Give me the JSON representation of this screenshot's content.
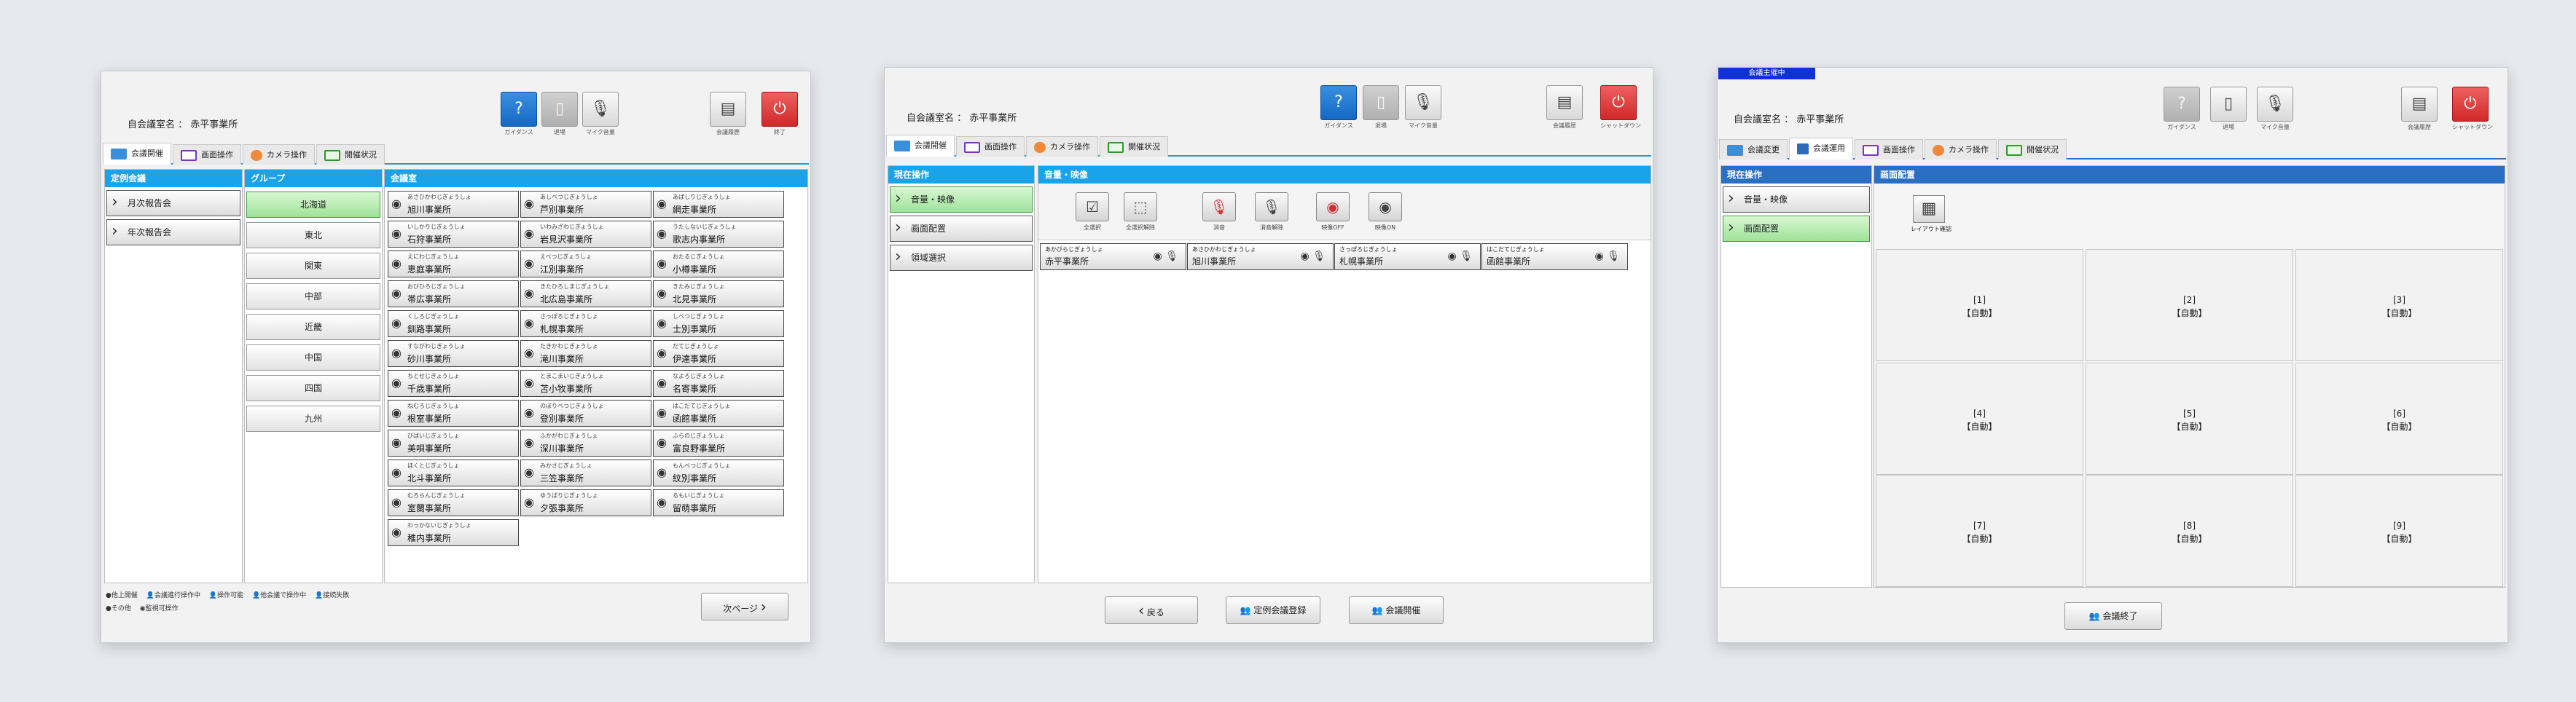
{
  "room_label": "自会議室名 ： 赤平事業所",
  "toolbar": {
    "guidance": "ガイダンス",
    "exit_room": "退場",
    "mic_volume": "マイク音量",
    "meeting_history": "会議履歴",
    "shutdown": "シャットダウン",
    "end": "終了"
  },
  "icons": {
    "guidance": "question-icon",
    "exit": "door-icon",
    "mic": "mic-icon",
    "history": "document-icon",
    "power": "power-icon",
    "chevron": "chevron-right-icon",
    "eye": "eye-icon"
  },
  "colors": {
    "accent": "#1aa3e8",
    "selected": "#9fe29a",
    "danger": "#d02828"
  },
  "tabs": [
    "会議開催",
    "画面操作",
    "カメラ操作",
    "開催状況"
  ],
  "panel1": {
    "col_meetings": {
      "header": "定例会議",
      "items": [
        "月次報告会",
        "年次報告会"
      ]
    },
    "col_groups": {
      "header": "グループ",
      "items": [
        "北海道",
        "東北",
        "関東",
        "中部",
        "近畿",
        "中国",
        "四国",
        "九州"
      ]
    },
    "col_sites": {
      "header": "会議室",
      "items": [
        {
          "kana": "あさひかわじぎょうしょ",
          "name": "旭川事業所"
        },
        {
          "kana": "あしべつじぎょうしょ",
          "name": "芦別事業所"
        },
        {
          "kana": "あばしりじぎょうしょ",
          "name": "網走事業所"
        },
        {
          "kana": "いしかりじぎょうしょ",
          "name": "石狩事業所"
        },
        {
          "kana": "いわみざわじぎょうしょ",
          "name": "岩見沢事業所"
        },
        {
          "kana": "うたしないじぎょうしょ",
          "name": "歌志内事業所"
        },
        {
          "kana": "えにわじぎょうしょ",
          "name": "恵庭事業所"
        },
        {
          "kana": "えべつじぎょうしょ",
          "name": "江別事業所"
        },
        {
          "kana": "おたるじぎょうしょ",
          "name": "小樽事業所"
        },
        {
          "kana": "おびひろじぎょうしょ",
          "name": "帯広事業所"
        },
        {
          "kana": "きたひろしまじぎょうしょ",
          "name": "北広島事業所"
        },
        {
          "kana": "きたみじぎょうしょ",
          "name": "北見事業所"
        },
        {
          "kana": "くしろじぎょうしょ",
          "name": "釧路事業所"
        },
        {
          "kana": "さっぽろじぎょうしょ",
          "name": "札幌事業所"
        },
        {
          "kana": "しべつじぎょうしょ",
          "name": "士別事業所"
        },
        {
          "kana": "すながわじぎょうしょ",
          "name": "砂川事業所"
        },
        {
          "kana": "たきかわじぎょうしょ",
          "name": "滝川事業所"
        },
        {
          "kana": "だてじぎょうしょ",
          "name": "伊達事業所"
        },
        {
          "kana": "ちとせじぎょうしょ",
          "name": "千歳事業所"
        },
        {
          "kana": "とまこまいじぎょうしょ",
          "name": "苫小牧事業所"
        },
        {
          "kana": "なよろじぎょうしょ",
          "name": "名寄事業所"
        },
        {
          "kana": "ねむろじぎょうしょ",
          "name": "根室事業所"
        },
        {
          "kana": "のぼりべつじぎょうしょ",
          "name": "登別事業所"
        },
        {
          "kana": "はこだてじぎょうしょ",
          "name": "函館事業所"
        },
        {
          "kana": "びばいじぎょうしょ",
          "name": "美唄事業所"
        },
        {
          "kana": "ふかがわじぎょうしょ",
          "name": "深川事業所"
        },
        {
          "kana": "ふらのじぎょうしょ",
          "name": "富良野事業所"
        },
        {
          "kana": "ほくとじぎょうしょ",
          "name": "北斗事業所"
        },
        {
          "kana": "みかさじぎょうしょ",
          "name": "三笠事業所"
        },
        {
          "kana": "もんべつじぎょうしょ",
          "name": "紋別事業所"
        },
        {
          "kana": "むろらんじぎょうしょ",
          "name": "室蘭事業所"
        },
        {
          "kana": "ゆうばりじぎょうしょ",
          "name": "夕張事業所"
        },
        {
          "kana": "るもいじぎょうしょ",
          "name": "留萌事業所"
        },
        {
          "kana": "わっかないじぎょうしょ",
          "name": "稚内事業所"
        }
      ]
    },
    "legend": {
      "l1": "●他上開催",
      "l2": "会議進行操作中",
      "l3": "操作可能",
      "l4": "他会議で操作中",
      "l5": "接続失敗",
      "l6": "●その他",
      "l7": "監視可操作"
    },
    "next_page": "次ページ"
  },
  "panel2": {
    "left_header": "現在操作",
    "left_items": [
      "音量・映像",
      "画面配置",
      "領域選択"
    ],
    "right_header": "音量・映像",
    "controls": [
      "全選択",
      "全選択解除",
      "消音",
      "消音解除",
      "映像OFF",
      "映像ON"
    ],
    "sites": [
      {
        "kana": "あかびらじぎょうしょ",
        "name": "赤平事業所"
      },
      {
        "kana": "あさひかわじぎょうしょ",
        "name": "旭川事業所"
      },
      {
        "kana": "さっぽろじぎょうしょ",
        "name": "札幌事業所"
      },
      {
        "kana": "はこだてじぎょうしょ",
        "name": "函館事業所"
      }
    ],
    "buttons": {
      "back": "戻る",
      "register": "定例会議登録",
      "start": "会議開催"
    }
  },
  "panel3": {
    "badge": "会議主催中",
    "tabs": [
      "会議変更",
      "会議運用",
      "画面操作",
      "カメラ操作",
      "開催状況"
    ],
    "left_header": "現在操作",
    "left_items": [
      "音量・映像",
      "画面配置"
    ],
    "right_header": "画面配置",
    "layout_label": "レイアウト確認",
    "cells": [
      {
        "n": "[1]",
        "m": "【自動】"
      },
      {
        "n": "[2]",
        "m": "【自動】"
      },
      {
        "n": "[3]",
        "m": "【自動】"
      },
      {
        "n": "[4]",
        "m": "【自動】"
      },
      {
        "n": "[5]",
        "m": "【自動】"
      },
      {
        "n": "[6]",
        "m": "【自動】"
      },
      {
        "n": "[7]",
        "m": "【自動】"
      },
      {
        "n": "[8]",
        "m": "【自動】"
      },
      {
        "n": "[9]",
        "m": "【自動】"
      }
    ],
    "end_button": "会議終了"
  }
}
